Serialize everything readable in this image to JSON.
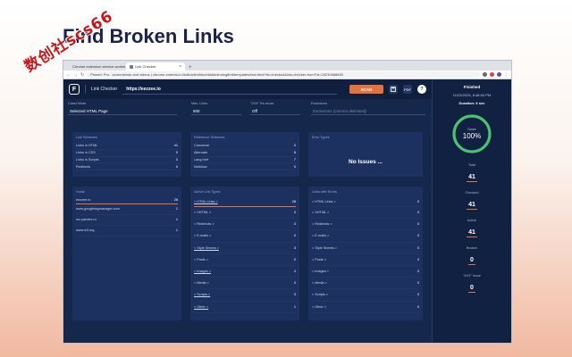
{
  "headline": "Find Broken Links",
  "watermark": "数创社scs66",
  "browser": {
    "tabs": [
      {
        "label": "Chrome extension service-worker",
        "active": false
      },
      {
        "label": "Link Checker",
        "active": true
      }
    ],
    "address": "Pinned: Pro - screenshots and videos | chrome-extension://kdbcldimlhfuohbkbknlmdngfimf/templates/test.html?fd=checked&link-checker-fromTld=20230688890"
  },
  "app": {
    "logo_glyph": "F",
    "title": "Link Checker",
    "url": "https://eezzee.io",
    "scan_label": "SCAN",
    "pdf_label": "PDF",
    "info_label": "?",
    "options": {
      "crawl_mode": {
        "label": "Crawl Mode",
        "value": "Selected HTML Page"
      },
      "max_links": {
        "label": "Max. Links",
        "value": "500"
      },
      "reuse": {
        "label": "\"2XX\" Re-reuse",
        "value": "Off"
      },
      "exclusions": {
        "label": "Exclusions",
        "placeholder": "Exclusions (comma delimited)"
      }
    },
    "link_schemes": {
      "title": "Link Schemes",
      "rows": [
        {
          "label": "Links in HTML",
          "value": "41"
        },
        {
          "label": "Links in CSS",
          "value": "0"
        },
        {
          "label": "Links in Scripts",
          "value": "0"
        },
        {
          "label": "Redirects",
          "value": "0"
        }
      ]
    },
    "reference_schemes": {
      "title": "Reference Schemes",
      "rows": [
        {
          "label": "Canonical",
          "value": "0"
        },
        {
          "label": "Alternate",
          "value": "8"
        },
        {
          "label": "Lang href",
          "value": "7"
        },
        {
          "label": "Nofollow",
          "value": "0"
        }
      ]
    },
    "error_types": {
      "title": "Error Types",
      "message": "No Issues ..."
    },
    "hosts": {
      "title": "Hosts",
      "rows": [
        {
          "label": "eezzee.io",
          "value": "28"
        },
        {
          "label": "www.googletagmanager.com",
          "value": "1"
        },
        {
          "label": "mc.yandex.ru",
          "value": "1"
        },
        {
          "label": "www.w3.org",
          "value": "1"
        }
      ]
    },
    "active_link_types": {
      "title": "Active Link Types",
      "rows": [
        {
          "label": "< HTML Links >",
          "value": "28"
        },
        {
          "label": "< XHTML >",
          "value": "0"
        },
        {
          "label": "< Redirects >",
          "value": "0"
        },
        {
          "label": "< E-mails >",
          "value": "0"
        },
        {
          "label": "< Style Sheets >",
          "value": "3"
        },
        {
          "label": "< Posts >",
          "value": "0"
        },
        {
          "label": "< Images >",
          "value": "4"
        },
        {
          "label": "< Media >",
          "value": "0"
        },
        {
          "label": "< Scripts >",
          "value": "3"
        },
        {
          "label": "< Other >",
          "value": "1"
        }
      ]
    },
    "links_with_errors": {
      "title": "Links with Errors",
      "rows": [
        {
          "label": "< HTML Links >",
          "value": "0"
        },
        {
          "label": "< XHTML >",
          "value": "0"
        },
        {
          "label": "< Redirects >",
          "value": "0"
        },
        {
          "label": "< E-mails >",
          "value": "0"
        },
        {
          "label": "< Style Sheets >",
          "value": "0"
        },
        {
          "label": "< Posts >",
          "value": "0"
        },
        {
          "label": "< Images >",
          "value": "0"
        },
        {
          "label": "< Media >",
          "value": "0"
        },
        {
          "label": "< Scripts >",
          "value": "0"
        },
        {
          "label": "< Other >",
          "value": "0"
        }
      ]
    },
    "summary": {
      "status": "Finished",
      "date": "11/23/2023, 8:48:54 PM",
      "duration": "Duration: 6 sec",
      "score_label": "Score",
      "score_value": "100%",
      "score_fraction": 1.0,
      "stats": [
        {
          "label": "Total",
          "value": "41"
        },
        {
          "label": "Checked",
          "value": "41"
        },
        {
          "label": "Active",
          "value": "41"
        },
        {
          "label": "Broken",
          "value": "0"
        },
        {
          "label": "\"4XX\" Issue",
          "value": "0"
        }
      ]
    },
    "colors": {
      "accent": "#e3723f",
      "gauge": "#4cc16f",
      "bg": "#15274b",
      "panel": "#1c3160"
    }
  }
}
